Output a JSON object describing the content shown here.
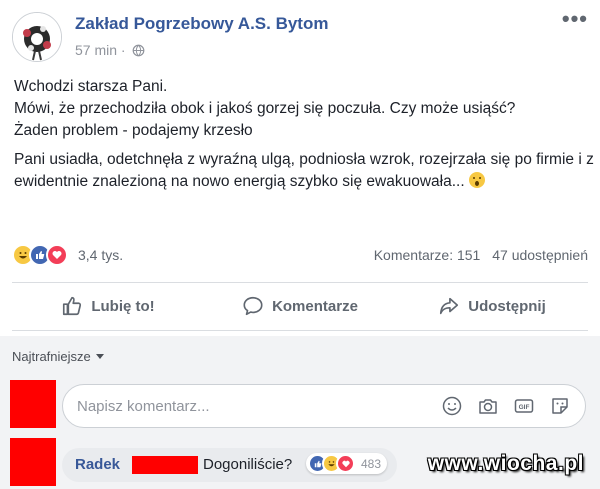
{
  "post": {
    "page_name": "Zakład Pogrzebowy A.S. Bytom",
    "time": "57 min ·",
    "paragraphs": [
      "Wchodzi starsza Pani.",
      "Mówi, że przechodziła obok i jakoś gorzej się poczuła. Czy może usiąść?",
      "Żaden problem - podajemy krzesło",
      "Pani usiadła, odetchnęła z wyraźną ulgą, podniosła wzrok, rozejrzała się po firmie i z ewidentnie znalezioną na nowo energią szybko się ewakuowała..."
    ],
    "reactions_count": "3,4 tys.",
    "comments_count": "Komentarze: 151",
    "shares_count": "47 udostępnień"
  },
  "actions": {
    "like": "Lubię to!",
    "comment": "Komentarze",
    "share": "Udostępnij"
  },
  "comments": {
    "sort_label": "Najtrafniejsze",
    "input_placeholder": "Napisz komentarz...",
    "first": {
      "author": "Radek",
      "text": "Dogoniliście?",
      "reactions": "483"
    }
  },
  "watermark": "www.wiocha.pl",
  "colors": {
    "link_blue": "#365899",
    "redaction": "#ff0000",
    "like_blue": "#4267b2",
    "love_red": "#f33e58",
    "haha_yellow": "#f7c843"
  }
}
